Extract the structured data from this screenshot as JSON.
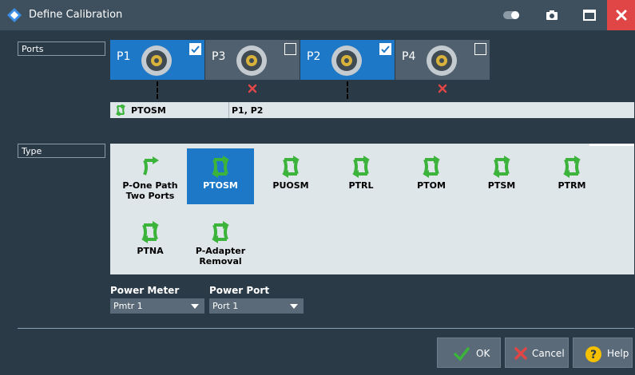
{
  "window": {
    "title": "Define Calibration"
  },
  "sections": {
    "ports_label": "Ports",
    "type_label": "Type"
  },
  "ports": [
    {
      "name": "P1",
      "checked": true
    },
    {
      "name": "P3",
      "checked": false
    },
    {
      "name": "P2",
      "checked": true
    },
    {
      "name": "P4",
      "checked": false
    }
  ],
  "summary": {
    "type": "PTOSM",
    "ports": "P1, P2"
  },
  "types": [
    {
      "label": "P-One Path Two Ports",
      "line1": "P-One Path",
      "line2": "Two Ports",
      "selected": false
    },
    {
      "label": "PTOSM",
      "line1": "PTOSM",
      "line2": "",
      "selected": true
    },
    {
      "label": "PUOSM",
      "line1": "PUOSM",
      "line2": "",
      "selected": false
    },
    {
      "label": "PTRL",
      "line1": "PTRL",
      "line2": "",
      "selected": false
    },
    {
      "label": "PTOM",
      "line1": "PTOM",
      "line2": "",
      "selected": false
    },
    {
      "label": "PTSM",
      "line1": "PTSM",
      "line2": "",
      "selected": false
    },
    {
      "label": "PTRM",
      "line1": "PTRM",
      "line2": "",
      "selected": false
    },
    {
      "label": "PTNA",
      "line1": "PTNA",
      "line2": "",
      "selected": false
    },
    {
      "label": "P-Adapter Removal",
      "line1": "P-Adapter",
      "line2": "Removal",
      "selected": false
    }
  ],
  "power_meter": {
    "label": "Power Meter",
    "value": "Pmtr 1"
  },
  "power_port": {
    "label": "Power Port",
    "value": "Port 1"
  },
  "buttons": {
    "ok": "OK",
    "cancel": "Cancel",
    "help": "Help"
  },
  "colors": {
    "accent": "#1e78c8",
    "background": "#2b3a47",
    "titlebar": "#3e4f5e",
    "close": "#e04646",
    "icon_green": "#3cb43c",
    "error_red": "#e04646",
    "help_yellow": "#f5c000"
  }
}
